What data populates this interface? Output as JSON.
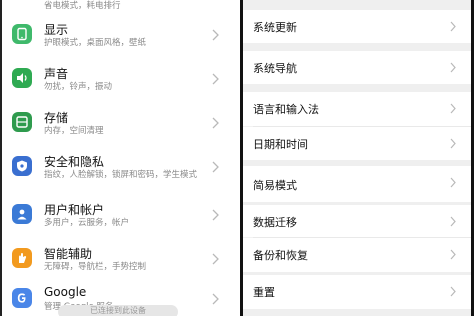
{
  "left": {
    "top_partial_subtitle": "省电模式，耗电排行",
    "items": [
      {
        "title": "显示",
        "subtitle": "护眼模式，桌面风格，壁纸",
        "icon": "display-icon",
        "color": "#3fb96b"
      },
      {
        "title": "声音",
        "subtitle": "勿扰，铃声，振动",
        "icon": "sound-icon",
        "color": "#2faa52"
      },
      {
        "title": "存储",
        "subtitle": "内存，空间清理",
        "icon": "storage-icon",
        "color": "#2f9b4e"
      },
      {
        "title": "安全和隐私",
        "subtitle": "指纹，人脸解锁，锁屏和密码，学生模式",
        "icon": "shield-icon",
        "color": "#3a6fd0"
      },
      {
        "title": "用户和帐户",
        "subtitle": "多用户，云服务，帐户",
        "icon": "user-icon",
        "color": "#3b7ad6"
      },
      {
        "title": "智能辅助",
        "subtitle": "无障碍，导航栏，手势控制",
        "icon": "hand-icon",
        "color": "#f29a1f"
      },
      {
        "title": "Google",
        "subtitle": "管理 Google 服务",
        "icon": "google-icon",
        "color": "#4a86e8"
      }
    ],
    "toast_text": "已连接到此设备"
  },
  "right": {
    "items": [
      {
        "title": "系统更新"
      },
      {
        "title": "系统导航"
      },
      {
        "title": "语言和输入法"
      },
      {
        "title": "日期和时间"
      },
      {
        "title": "简易模式"
      },
      {
        "title": "数据迁移"
      },
      {
        "title": "备份和恢复"
      },
      {
        "title": "重置"
      }
    ],
    "highlight_color": "#d9362e"
  }
}
